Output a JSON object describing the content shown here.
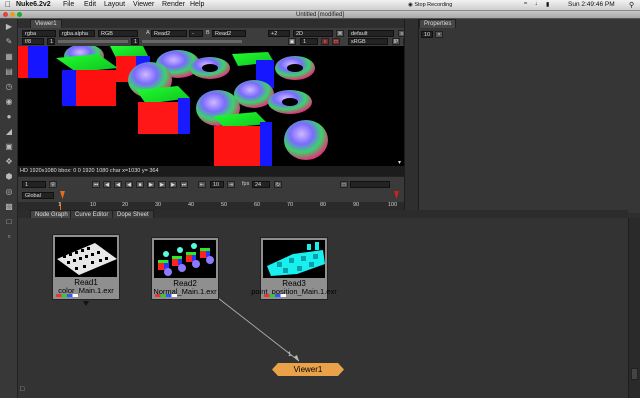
{
  "menubar": {
    "apple": "",
    "app_name": "Nuke6.2v2",
    "items": [
      "File",
      "Edit",
      "Layout",
      "Viewer",
      "Render",
      "Help"
    ],
    "recording": "Stop Recording",
    "clock": "Sun 2:49:46 PM"
  },
  "window": {
    "title": "Untitled [modified]"
  },
  "viewer": {
    "tab": "Viewer1",
    "channels": "rgba",
    "alpha": "rgba.alpha",
    "colorspace": "RGB",
    "a_label": "A",
    "a_input": "Read2",
    "b_label": "B",
    "b_input": "Read2",
    "zoom": "+2",
    "view_mode": "2D",
    "lut": "default",
    "frame_ratio": "f/8",
    "gain": "1",
    "gamma": "1",
    "proxy": "1",
    "display": "sRGB",
    "info": "HD 1920x1080  bbox: 0 0 1920 1080 char   x=1030 y= 364"
  },
  "playback": {
    "frame": "1",
    "frame_step": "10",
    "fps_label": "fps",
    "fps": "24",
    "global": "Global",
    "ticks": [
      "1",
      "10",
      "20",
      "30",
      "40",
      "50",
      "60",
      "70",
      "80",
      "90",
      "100"
    ]
  },
  "graph_tabs": [
    "Node Graph",
    "Curve Editor",
    "Dope Sheet"
  ],
  "properties": {
    "tab": "Properties",
    "count": "10"
  },
  "nodes": [
    {
      "name": "Read1",
      "file": "color_Main.1.exr"
    },
    {
      "name": "Read2",
      "file": "Normal_Main.1.exr"
    },
    {
      "name": "Read3",
      "file": "point_position_Main.1.exr"
    }
  ],
  "viewer_node": {
    "name": "Viewer1",
    "input": "1"
  },
  "colors": {
    "viewer_node": "#e9a24a",
    "node_body": "#8f8f8f",
    "panel": "#333333"
  }
}
